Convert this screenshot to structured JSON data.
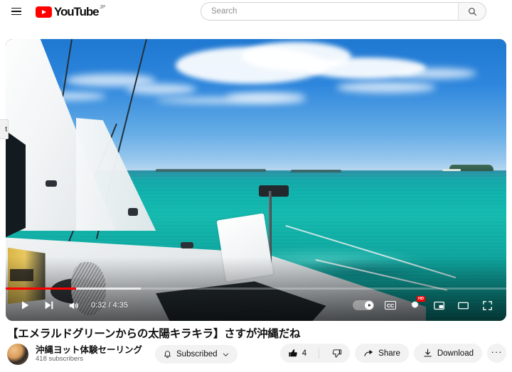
{
  "header": {
    "menu_label": "Guide menu",
    "logo_text": "YouTube",
    "logo_country": "JP",
    "search_placeholder": "Search",
    "search_value": "",
    "search_button_label": "Search"
  },
  "player": {
    "current_time": "0:32",
    "total_time": "4:35",
    "time_display": "0:32 / 4:35",
    "progress_percent": 14,
    "buffered_percent": 27,
    "play_label": "Play",
    "next_label": "Next",
    "volume_label": "Mute",
    "autoplay_label": "Autoplay is on",
    "autoplay_on": true,
    "captions_label": "CC",
    "settings_label": "Settings",
    "quality_badge": "HD",
    "miniplayer_label": "Miniplayer",
    "theater_label": "Theater mode",
    "fullscreen_label": "Full screen",
    "clipped_overlay_text": "t"
  },
  "video": {
    "title": "【エメラルドグリーンからの太陽キラキラ】さすが沖縄だね",
    "channel_name": "沖縄ヨット体験セーリング",
    "subscriber_count": "418 subscribers",
    "subscribe_label": "Subscribed",
    "like_count": "4",
    "share_label": "Share",
    "download_label": "Download",
    "more_label": "···"
  },
  "colors": {
    "brand_red": "#ff0000",
    "progress_red": "#ff0000",
    "pill_background": "#f2f2f2",
    "text_primary": "#0f0f0f",
    "text_secondary": "#606060"
  }
}
